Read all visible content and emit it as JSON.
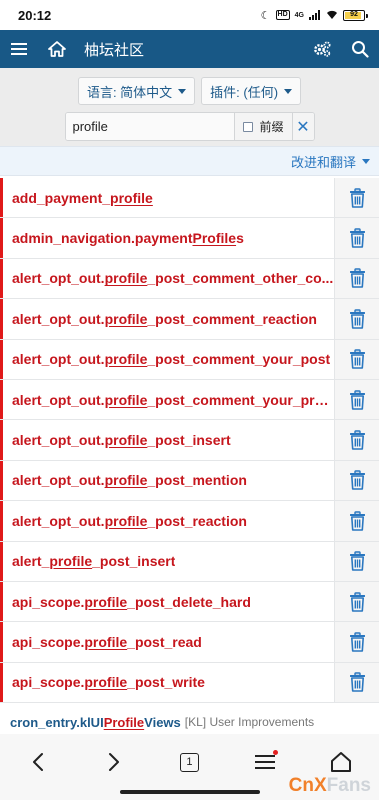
{
  "status_bar": {
    "time": "20:12",
    "network": "4G",
    "hd": "HD",
    "battery_percent": "92",
    "battery_level": 0.92
  },
  "app_bar": {
    "title": "柚坛社区",
    "icons": [
      "menu-icon",
      "home-icon",
      "settings-cog-icon",
      "search-icon"
    ],
    "background": "#185886"
  },
  "filters": {
    "language_label": "语言: 简体中文",
    "addon_label": "插件: (任何)",
    "search_value": "profile",
    "prefix_label": "前缀",
    "prefix_checked": false
  },
  "improve_link": "改进和翻译",
  "phrases": [
    {
      "pre": "add_payment_",
      "hl": "profile",
      "post": ""
    },
    {
      "pre": "admin_navigation.payment",
      "hl": "Profile",
      "post": "s"
    },
    {
      "pre": "alert_opt_out.",
      "hl": "profile",
      "post": "_post_comment_other_co..."
    },
    {
      "pre": "alert_opt_out.",
      "hl": "profile",
      "post": "_post_comment_reaction"
    },
    {
      "pre": "alert_opt_out.",
      "hl": "profile",
      "post": "_post_comment_your_post"
    },
    {
      "pre": "alert_opt_out.",
      "hl": "profile",
      "post": "_post_comment_your_pro..."
    },
    {
      "pre": "alert_opt_out.",
      "hl": "profile",
      "post": "_post_insert"
    },
    {
      "pre": "alert_opt_out.",
      "hl": "profile",
      "post": "_post_mention"
    },
    {
      "pre": "alert_opt_out.",
      "hl": "profile",
      "post": "_post_reaction"
    },
    {
      "pre": "alert_",
      "hl": "profile",
      "post": "_post_insert"
    },
    {
      "pre": "api_scope.",
      "hl": "profile",
      "post": "_post_delete_hard"
    },
    {
      "pre": "api_scope.",
      "hl": "profile",
      "post": "_post_read"
    },
    {
      "pre": "api_scope.",
      "hl": "profile",
      "post": "_post_write"
    }
  ],
  "partial_row": {
    "pre": "cron_entry.klUI",
    "hl": "Profile",
    "post": "Views",
    "addon": "[KL] User Improvements"
  },
  "bottom_nav": {
    "tab_count": "1",
    "icons": [
      "back-icon",
      "forward-icon",
      "tabs-icon",
      "menu-icon",
      "home-icon"
    ]
  },
  "watermark": {
    "a": "CnX",
    "b": "Fans"
  },
  "colors": {
    "phrase_text": "#c6161d",
    "accent_blue": "#2a77c0",
    "row_marker": "#e01919"
  }
}
